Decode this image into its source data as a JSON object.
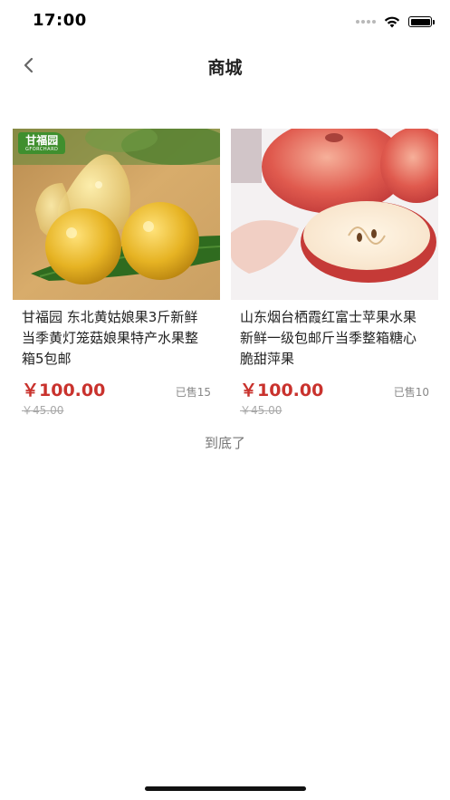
{
  "status_bar": {
    "time": "17:00"
  },
  "nav": {
    "title": "商城",
    "back_icon": "chevron-left-icon"
  },
  "products": [
    {
      "title": "甘福园 东北黄姑娘果3斤新鲜当季黄灯笼菇娘果特产水果整箱5包邮",
      "price": "￥100.00",
      "old_price": "￥45.00",
      "sold": "已售15",
      "brand": {
        "name": "甘福园",
        "sub": "GFORCHARD"
      }
    },
    {
      "title": "山东烟台栖霞红富士苹果水果新鲜一级包邮斤当季整箱糖心脆甜萍果",
      "price": "￥100.00",
      "old_price": "￥45.00",
      "sold": "已售10"
    }
  ],
  "end_text": "到底了",
  "colors": {
    "price": "#c9322d",
    "brand_badge": "#3f8f2e"
  }
}
